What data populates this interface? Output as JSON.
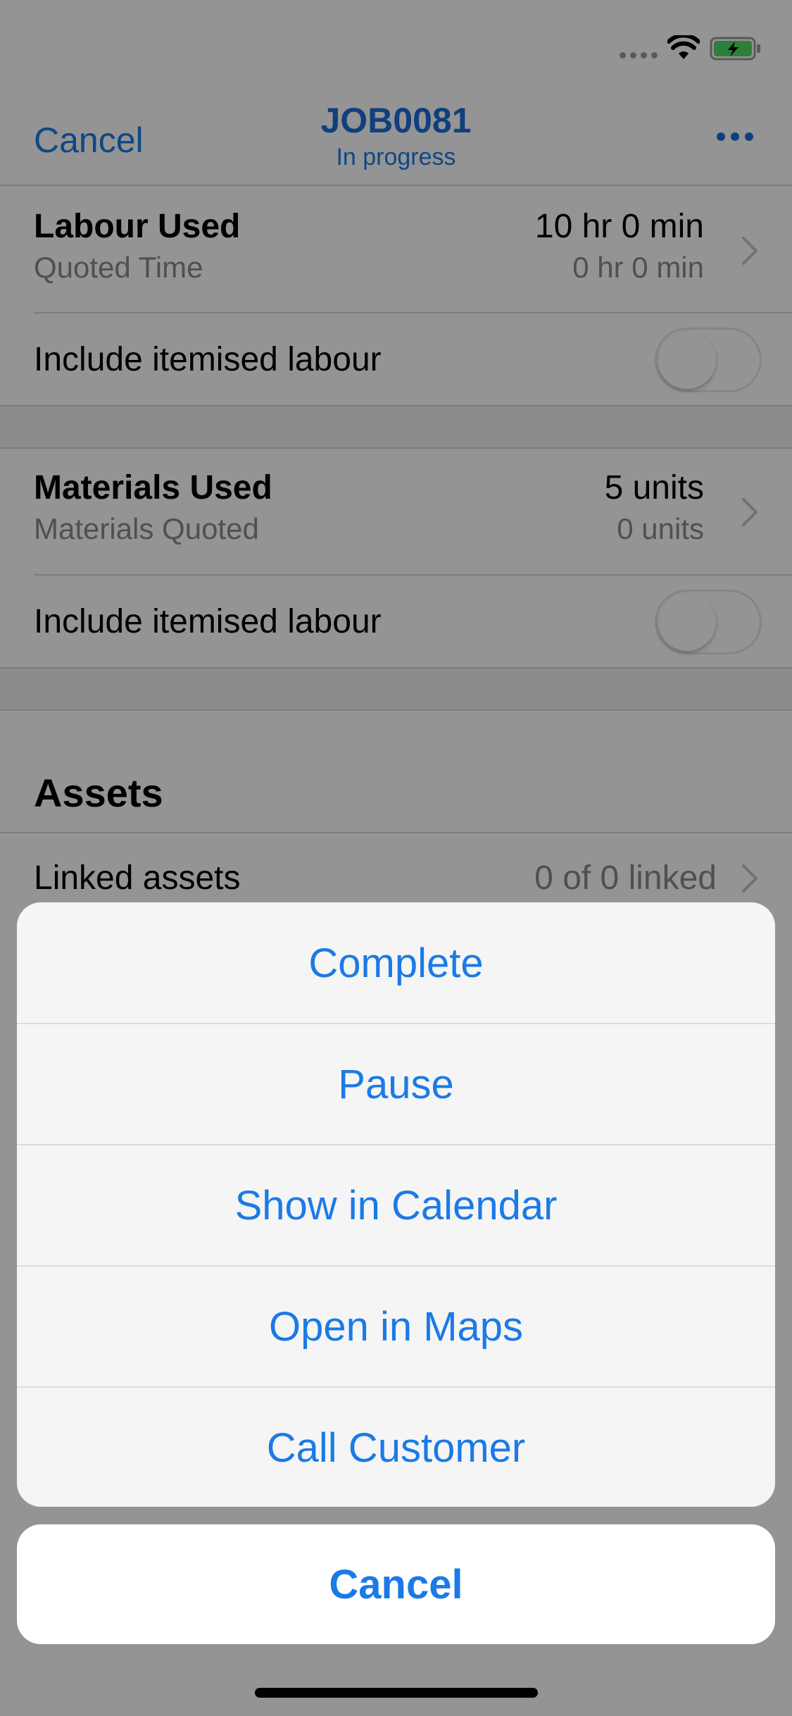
{
  "nav": {
    "cancel_label": "Cancel",
    "title": "JOB0081",
    "subtitle": "In progress"
  },
  "labour": {
    "title": "Labour Used",
    "subtitle": "Quoted Time",
    "value": "10 hr 0 min",
    "value_sub": "0 hr 0 min",
    "toggle_label": "Include itemised labour",
    "toggle_on": false
  },
  "materials": {
    "title": "Materials Used",
    "subtitle": "Materials Quoted",
    "value": "5 units",
    "value_sub": "0 units",
    "toggle_label": "Include itemised labour",
    "toggle_on": false
  },
  "assets": {
    "header": "Assets",
    "linked_label": "Linked assets",
    "linked_value": "0 of 0 linked"
  },
  "action_sheet": {
    "actions": [
      "Complete",
      "Pause",
      "Show in Calendar",
      "Open in Maps",
      "Call Customer"
    ],
    "cancel_label": "Cancel"
  },
  "colors": {
    "accent": "#1b7ae6",
    "title_accent": "#1b6ed8",
    "secondary_text": "#8a8a8e",
    "battery_fill": "#4cd964"
  },
  "icons": [
    "wifi-icon",
    "battery-icon",
    "more-icon",
    "chevron-right-icon"
  ]
}
